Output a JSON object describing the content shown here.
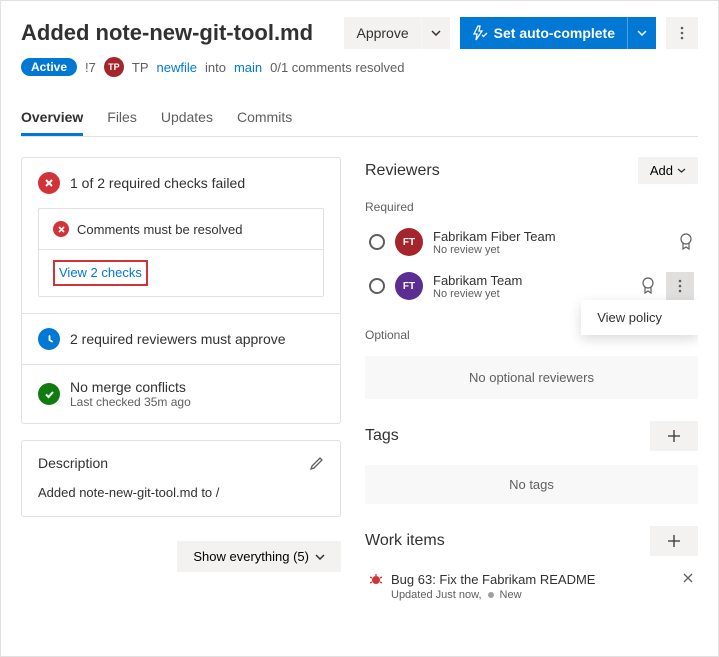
{
  "header": {
    "title": "Added note-new-git-tool.md",
    "approve_label": "Approve",
    "autocomplete_label": "Set auto-complete"
  },
  "meta": {
    "status": "Active",
    "pr_id": "!7",
    "avatar_initials": "TP",
    "author": "TP",
    "source_branch": "newfile",
    "into": "into",
    "target_branch": "main",
    "comments": "0/1 comments resolved"
  },
  "tabs": [
    "Overview",
    "Files",
    "Updates",
    "Commits"
  ],
  "checks": {
    "summary": "1 of 2 required checks failed",
    "items": [
      {
        "text": "Comments must be resolved"
      }
    ],
    "view_link": "View 2 checks"
  },
  "reviewers_required": {
    "text": "2 required reviewers must approve"
  },
  "merge": {
    "title": "No merge conflicts",
    "sub": "Last checked 35m ago"
  },
  "description": {
    "heading": "Description",
    "body": "Added note-new-git-tool.md to /"
  },
  "reviewers": {
    "title": "Reviewers",
    "add_label": "Add",
    "required_label": "Required",
    "optional_label": "Optional",
    "optional_empty": "No optional reviewers",
    "list": [
      {
        "initials": "FT",
        "name": "Fabrikam Fiber Team",
        "status": "No review yet",
        "color": "red"
      },
      {
        "initials": "FT",
        "name": "Fabrikam Team",
        "status": "No review yet",
        "color": "purple"
      }
    ],
    "popover": "View policy"
  },
  "tags": {
    "title": "Tags",
    "empty": "No tags"
  },
  "work_items": {
    "title": "Work items",
    "item": {
      "title": "Bug 63: Fix the Fabrikam README",
      "updated": "Updated Just now,",
      "state": "New"
    }
  },
  "footer": {
    "show_label": "Show everything (5)"
  }
}
